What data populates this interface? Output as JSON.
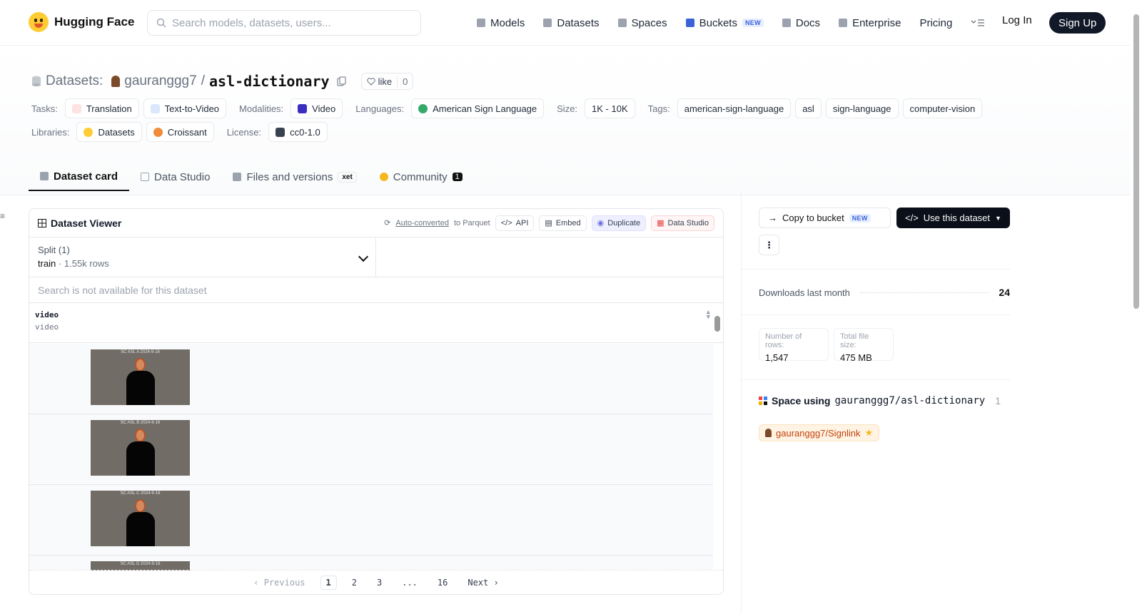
{
  "header": {
    "logo_text": "Hugging Face",
    "search_placeholder": "Search models, datasets, users...",
    "nav": [
      {
        "label": "Models",
        "icon": "cube-icon"
      },
      {
        "label": "Datasets",
        "icon": "database-icon"
      },
      {
        "label": "Spaces",
        "icon": "grid-icon"
      },
      {
        "label": "Buckets",
        "icon": "bucket-icon",
        "badge": "NEW"
      },
      {
        "label": "Docs",
        "icon": "book-icon"
      },
      {
        "label": "Enterprise",
        "icon": "enterprise-icon"
      },
      {
        "label": "Pricing"
      }
    ],
    "login": "Log In",
    "signup": "Sign Up"
  },
  "dataset": {
    "section_label": "Datasets:",
    "owner": "gauranggg7",
    "separator": "/",
    "name": "asl-dictionary",
    "like_label": "like",
    "like_count": "0"
  },
  "meta": {
    "tasks_label": "Tasks:",
    "tasks": [
      "Translation",
      "Text-to-Video"
    ],
    "modalities_label": "Modalities:",
    "modalities": [
      "Video"
    ],
    "languages_label": "Languages:",
    "languages": [
      "American Sign Language"
    ],
    "size_label": "Size:",
    "size": "1K - 10K",
    "tags_label": "Tags:",
    "tags": [
      "american-sign-language",
      "asl",
      "sign-language",
      "computer-vision"
    ],
    "libraries_label": "Libraries:",
    "libraries": [
      "Datasets",
      "Croissant"
    ],
    "license_label": "License:",
    "license": "cc0-1.0"
  },
  "tabs": [
    {
      "label": "Dataset card",
      "active": true
    },
    {
      "label": "Data Studio"
    },
    {
      "label": "Files and versions",
      "badge": "xet"
    },
    {
      "label": "Community",
      "count": "1"
    }
  ],
  "viewer": {
    "title": "Dataset Viewer",
    "auto_converted": "Auto-converted",
    "to_parquet": "to Parquet",
    "buttons": [
      "API",
      "Embed",
      "Duplicate",
      "Data Studio"
    ],
    "split_label": "Split (1)",
    "split_value": "train",
    "split_rows": "1.55k rows",
    "search_na": "Search is not available for this dataset",
    "column_name": "video",
    "column_type": "video",
    "rows": [
      {
        "caption": "SC ASL A 2024-9-16"
      },
      {
        "caption": "SC ASL B 2024-9-16"
      },
      {
        "caption": "SC ASL C 2024-9-16"
      },
      {
        "caption": "SC ASL D 2024-9-16"
      }
    ],
    "pager": {
      "previous": "Previous",
      "pages": [
        "1",
        "2",
        "3",
        "...",
        "16"
      ],
      "current": "1",
      "next": "Next"
    }
  },
  "sidebar": {
    "copy_bucket": "Copy to bucket",
    "copy_badge": "NEW",
    "use_dataset": "Use this dataset",
    "downloads_label": "Downloads last month",
    "downloads_value": "24",
    "rows_label": "Number of rows:",
    "rows_value": "1,547",
    "size_label": "Total file size:",
    "size_value": "475 MB",
    "spaces_title": "Space using",
    "spaces_repo": "gauranggg7/asl-dictionary",
    "spaces_count": "1",
    "space_chip": "gauranggg7/Signlink"
  },
  "colors": {
    "brand_dark": "#111827",
    "new_badge": "#3b63d8",
    "space_chip_text": "#c2410c"
  }
}
